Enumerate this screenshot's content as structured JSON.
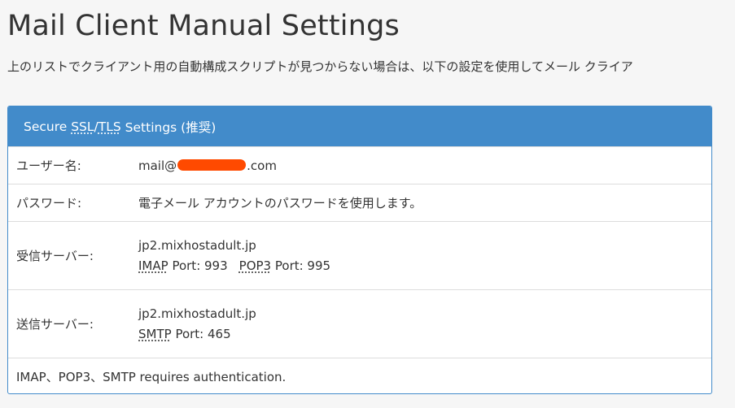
{
  "page": {
    "title": "Mail Client Manual Settings",
    "description": "上のリストでクライアント用の自動構成スクリプトが見つからない場合は、以下の設定を使用してメール クライア"
  },
  "panel": {
    "heading_prefix": "Secure ",
    "heading_ssl": "SSL",
    "heading_slash": "/",
    "heading_tls": "TLS",
    "heading_suffix": " Settings (推奨)",
    "username": {
      "label": "ユーザー名:",
      "value_prefix": "mail@",
      "value_suffix": ".com"
    },
    "password": {
      "label": "パスワード:",
      "value": "電子メール アカウントのパスワードを使用します。"
    },
    "incoming": {
      "label": "受信サーバー:",
      "host": "jp2.mixhostadult.jp",
      "imap_abbr": "IMAP",
      "imap_port_text": " Port: 993",
      "pop3_abbr": "POP3",
      "pop3_port_text": " Port: 995"
    },
    "outgoing": {
      "label": "送信サーバー:",
      "host": "jp2.mixhostadult.jp",
      "smtp_abbr": "SMTP",
      "smtp_port_text": " Port: 465"
    },
    "auth_note": "IMAP、POP3、SMTP requires authentication."
  },
  "colors": {
    "panel_accent": "#428bca",
    "redaction": "#ff4a00"
  }
}
